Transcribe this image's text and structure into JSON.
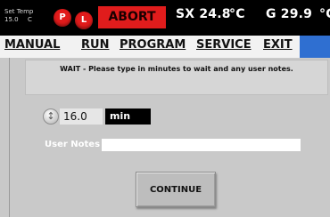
{
  "status": {
    "setpoint_label": "Set Temp",
    "setpoint_value": "15.0",
    "setpoint_unit": "C",
    "indicator_p": "P",
    "indicator_l": "L",
    "abort_label": "ABORT",
    "sx_reading": "SX 24.8",
    "sx_unit": "°C",
    "g_reading": "G 29.9",
    "g_unit": "°C"
  },
  "menu": {
    "items": [
      "MANUAL",
      "RUN",
      "PROGRAM",
      "SERVICE",
      "EXIT"
    ]
  },
  "form": {
    "message": "WAIT - Please type in minutes to wait and any user notes.",
    "minutes_value": "16.0",
    "minutes_unit": "min",
    "notes_label": "User Notes",
    "notes_value": "",
    "continue_label": "CONTINUE"
  },
  "colors": {
    "abort": "#e01c1c",
    "indicator": "#e21b1b",
    "menu_accent": "#2f6fd1",
    "content_bg": "#c9c9c9"
  }
}
